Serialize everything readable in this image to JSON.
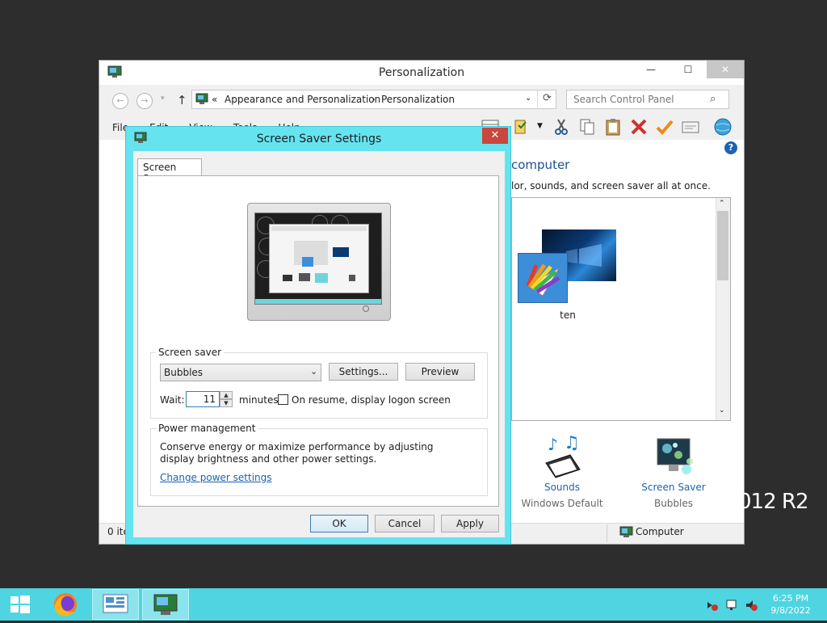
{
  "personalization": {
    "title": "Personalization",
    "address": [
      "«",
      "Appearance and Personalization",
      "Personalization"
    ],
    "search_placeholder": "Search Control Panel",
    "menu": [
      "File",
      "Edit",
      "View",
      "Tools",
      "Help"
    ],
    "heading": "computer",
    "description": "lor, sounds, and screen saver all at once.",
    "theme_name": "ten",
    "bottom_items": [
      {
        "label": "Sounds",
        "sub": "Windows Default"
      },
      {
        "label": "Screen Saver",
        "sub": "Bubbles"
      }
    ],
    "status_left": "0 ite",
    "status_right": "Computer"
  },
  "watermark": "012 R2",
  "dialog": {
    "title": "Screen Saver Settings",
    "tab": "Screen Saver",
    "screen_saver_group": "Screen saver",
    "selected_saver": "Bubbles",
    "settings_label": "Settings...",
    "preview_label": "Preview",
    "wait_label": "Wait:",
    "wait_value": "11",
    "minutes_label": "minutes",
    "resume_label": "On resume, display logon screen",
    "resume_checked": false,
    "power_group": "Power management",
    "power_text": "Conserve energy or maximize performance by adjusting display brightness and other power settings.",
    "power_link": "Change power settings",
    "ok_label": "OK",
    "cancel_label": "Cancel",
    "apply_label": "Apply"
  },
  "taskbar": {
    "clock_time": "6:25 PM",
    "clock_date": "9/8/2022",
    "apps": [
      "firefox-icon",
      "control-panel-icon",
      "personalization-icon"
    ]
  },
  "colors": {
    "taskbar": "#4ed5e1",
    "dialog_frame": "#65e4f0",
    "dialog_close": "#c9473d",
    "link": "#1a62b0"
  }
}
